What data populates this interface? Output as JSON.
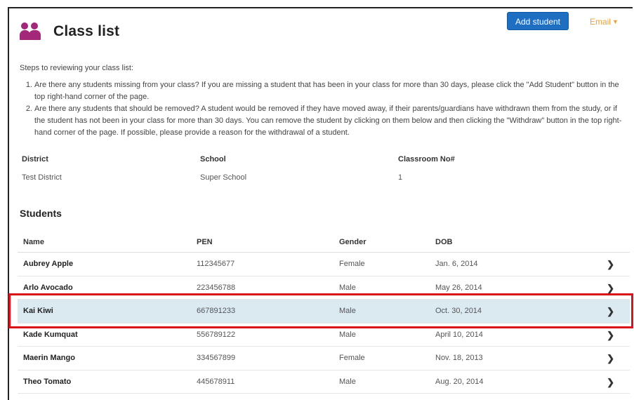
{
  "header": {
    "title": "Class list",
    "icon": "people-icon",
    "icon_color": "#a4287a"
  },
  "toolbar": {
    "add_student_label": "Add student",
    "email_label": "Email",
    "email_caret": "▼",
    "accent": "#1e6fc2",
    "email_color": "#e8a23a"
  },
  "instructions": {
    "title": "Steps to reviewing your class list:",
    "steps": [
      {
        "num": "1.",
        "text": "Are there any students missing from your class? If you are missing a student that has been in your class for more than 30 days, please click the \"Add Student\" button in the top right-hand corner of the page."
      },
      {
        "num": "2.",
        "text": "Are there any students that should be removed? A student would be removed if they have moved away, if their parents/guardians have withdrawn them from the study, or if the student has not been in your class for more than 30 days. You can remove the student by clicking on them below and then clicking the \"Withdraw\" button in the top right-hand corner of the page. If possible, please provide a reason for the withdrawal of a student."
      }
    ]
  },
  "class_info": {
    "district_label": "District",
    "district": "Test District",
    "school_label": "School",
    "school": "Super School",
    "classroom_label": "Classroom No#",
    "classroom": "1"
  },
  "students": {
    "heading": "Students",
    "columns": [
      "Name",
      "PEN",
      "Gender",
      "DOB"
    ],
    "rows": [
      {
        "name": "Aubrey Apple",
        "pen": "112345677",
        "gender": "Female",
        "dob": "Jan. 6, 2014",
        "highlighted": false
      },
      {
        "name": "Arlo Avocado",
        "pen": "223456788",
        "gender": "Male",
        "dob": "May 26, 2014",
        "highlighted": false
      },
      {
        "name": "Kai Kiwi",
        "pen": "667891233",
        "gender": "Male",
        "dob": "Oct. 30, 2014",
        "highlighted": true
      },
      {
        "name": "Kade Kumquat",
        "pen": "556789122",
        "gender": "Male",
        "dob": "April 10, 2014",
        "highlighted": false
      },
      {
        "name": "Maerin Mango",
        "pen": "334567899",
        "gender": "Female",
        "dob": "Nov. 18, 2013",
        "highlighted": false
      },
      {
        "name": "Theo Tomato",
        "pen": "445678911",
        "gender": "Male",
        "dob": "Aug. 20, 2014",
        "highlighted": false
      }
    ],
    "row_chevron": "❯",
    "highlight_color": "#dbe9f1",
    "selection_outline_color": "#d9111a"
  }
}
